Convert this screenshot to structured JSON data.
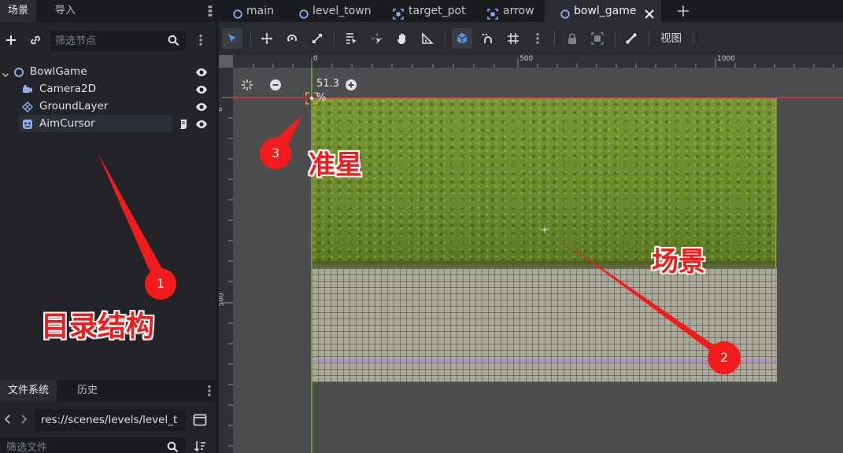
{
  "left_dock": {
    "tabs": [
      {
        "label": "场景",
        "active": true
      },
      {
        "label": "导入",
        "active": false
      }
    ],
    "filter_placeholder": "筛选节点",
    "tree": [
      {
        "label": "BowlGame",
        "icon": "node2d-icon",
        "expanded": true,
        "visible": true
      },
      {
        "label": "Camera2D",
        "icon": "camera2d-icon",
        "visible": true
      },
      {
        "label": "GroundLayer",
        "icon": "tilemap-layer-icon",
        "visible": true
      },
      {
        "label": "AimCursor",
        "icon": "sprite-icon",
        "selected": true,
        "has_script": true,
        "visible": true
      }
    ]
  },
  "filesystem": {
    "tabs": [
      {
        "label": "文件系统",
        "active": true
      },
      {
        "label": "历史",
        "active": false
      }
    ],
    "path": "res://scenes/levels/level_t",
    "filter_placeholder": "筛选文件"
  },
  "scene_tabs": [
    {
      "label": "main",
      "icon": "scene-node-icon"
    },
    {
      "label": "level_town",
      "icon": "scene-node-icon"
    },
    {
      "label": "target_pot",
      "icon": "scene-frame-icon"
    },
    {
      "label": "arrow",
      "icon": "scene-frame-icon"
    },
    {
      "label": "bowl_game",
      "icon": "scene-node-icon",
      "active": true,
      "closable": true
    }
  ],
  "toolbar": {
    "view_label": "视图",
    "active_tool": "select",
    "snap_enabled": true
  },
  "viewport": {
    "zoom_label": "51.3 %",
    "ruler_top": [
      "0",
      "500",
      "1000"
    ],
    "ruler_left": [
      "0",
      "500"
    ]
  },
  "annotations": {
    "label_1": "目录结构",
    "label_2": "场景",
    "label_3": "准星",
    "num_1": "1",
    "num_2": "2",
    "num_3": "3"
  },
  "colors": {
    "accent": "#5c93d6",
    "annotation_red": "#f31b1b",
    "axis_x": "#cf4a52",
    "axis_y": "#6b9b3a",
    "camera_frame": "#b07bd8"
  }
}
